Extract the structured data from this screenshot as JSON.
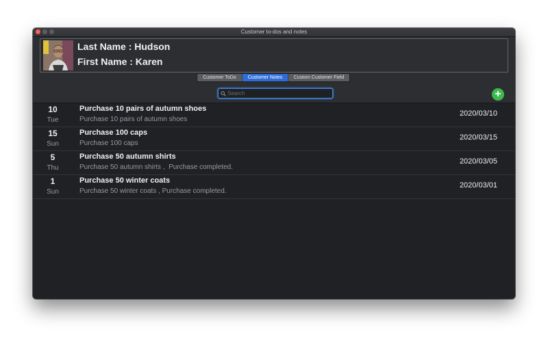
{
  "window": {
    "title": "Customer to-dos and notes"
  },
  "customer": {
    "last_name_line": "Last Name : Hudson",
    "first_name_line": "First Name : Karen"
  },
  "tabs": [
    {
      "label": "Customer ToDo",
      "selected": false
    },
    {
      "label": "Customer Notes",
      "selected": true
    },
    {
      "label": "Custom Customer Field",
      "selected": false
    }
  ],
  "search": {
    "placeholder": "Search",
    "value": "",
    "icon": "magnifier-icon"
  },
  "add_button": {
    "label": "+",
    "color": "#3dba4e"
  },
  "colors": {
    "accent": "#2f6cd6",
    "background": "#1f2125",
    "add": "#3dba4e"
  },
  "notes": [
    {
      "day": "10",
      "weekday": "Tue",
      "title": "Purchase 10 pairs of autumn shoes",
      "detail": "Purchase 10 pairs of autumn shoes",
      "date": "2020/03/10"
    },
    {
      "day": "15",
      "weekday": "Sun",
      "title": "Purchase 100 caps",
      "detail": "Purchase 100 caps",
      "date": "2020/03/15"
    },
    {
      "day": "5",
      "weekday": "Thu",
      "title": "Purchase 50 autumn shirts",
      "detail": "Purchase 50 autumn shirts ,  Purchase completed.",
      "date": "2020/03/05"
    },
    {
      "day": "1",
      "weekday": "Sun",
      "title": "Purchase 50 winter coats",
      "detail": "Purchase 50 winter coats , Purchase completed.",
      "date": "2020/03/01"
    }
  ]
}
